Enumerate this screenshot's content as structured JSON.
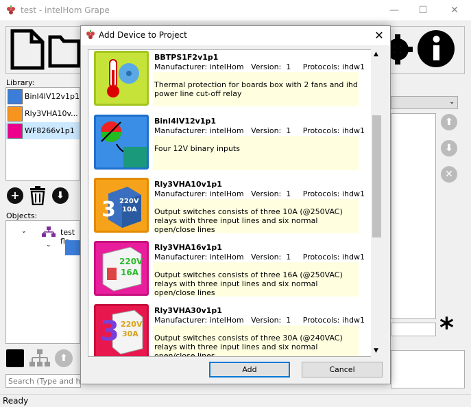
{
  "window": {
    "title": "test - intelHom Grape"
  },
  "library": {
    "label": "Library:",
    "items": [
      {
        "label": "BinI4IV12v1p1",
        "color": "#3b7dd8"
      },
      {
        "label": "Rly3VHA10v...",
        "color": "#f7941d"
      },
      {
        "label": "WF8266v1p1",
        "color": "#ec008c"
      }
    ]
  },
  "objects": {
    "label": "Objects:",
    "tree": [
      {
        "label": "test flo"
      }
    ]
  },
  "search": {
    "placeholder": "Search (Type and hit E"
  },
  "status": {
    "text": "Ready"
  },
  "dialog": {
    "title": "Add Device to Project",
    "add_label": "Add",
    "cancel_label": "Cancel",
    "devices": [
      {
        "name": "BBTPS1F2v1p1",
        "manufacturer": "Manufacturer: intelHom",
        "version": "Version:  1",
        "protocols": "Protocols: ihdw1",
        "description": "Thermal protection for boards box with 2 fans and ihd power line cut-off relay",
        "icon": "thermometer-fan-icon",
        "bg": "#c6e33a",
        "border": "#a4c420"
      },
      {
        "name": "BinI4IV12v1p1",
        "manufacturer": "Manufacturer: intelHom",
        "version": "Version:  1",
        "protocols": "Protocols: ihdw1",
        "description": "Four 12V binary inputs",
        "icon": "binary-input-icon",
        "bg": "#3a8ee6",
        "border": "#1f6fcc"
      },
      {
        "name": "Rly3VHA10v1p1",
        "manufacturer": "Manufacturer: intelHom",
        "version": "Version:  1",
        "protocols": "Protocols: ihdw1",
        "description": "Output switches consists of three 10A (@250VAC) relays with three input lines and six normal open/close lines",
        "icon": "relay-10a-icon",
        "bg": "#f7a21b",
        "border": "#e38a00",
        "badge_big": "3",
        "badge_v": "220V",
        "badge_a": "10A"
      },
      {
        "name": "Rly3VHA16v1p1",
        "manufacturer": "Manufacturer: intelHom",
        "version": "Version:  1",
        "protocols": "Protocols: ihdw1",
        "description": "Output switches consists of three 16A (@250VAC) relays with three input lines and six normal open/close lines",
        "icon": "relay-16a-icon",
        "bg": "#e81e9c",
        "border": "#c8107f",
        "badge_v": "220V",
        "badge_a": "16A"
      },
      {
        "name": "Rly3VHA30v1p1",
        "manufacturer": "Manufacturer: intelHom",
        "version": "Version:  1",
        "protocols": "Protocols: ihdw1",
        "description": "Output switches consists of three 30A (@240VAC) relays with three input lines and six normal open/close lines",
        "icon": "relay-30a-icon",
        "bg": "#e8184f",
        "border": "#c80f3c",
        "badge_big": "3",
        "badge_v": "220V",
        "badge_a": "30A"
      }
    ]
  }
}
